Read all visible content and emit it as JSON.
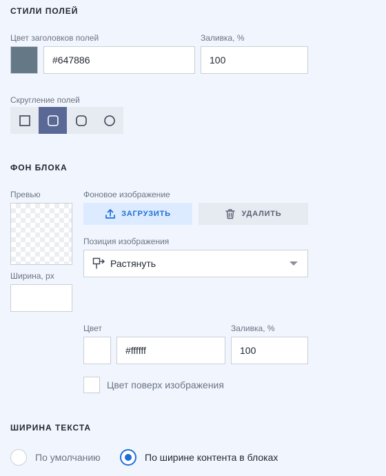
{
  "field_styles": {
    "title": "СТИЛИ ПОЛЕЙ",
    "header_color_label": "Цвет заголовков полей",
    "header_color_value": "#647886",
    "header_color_swatch": "#647886",
    "fill_label": "Заливка, %",
    "fill_value": "100",
    "rounding_label": "Скругление полей",
    "rounding_options": [
      {
        "icon": "square-corner-icon",
        "selected": false
      },
      {
        "icon": "small-rounded-corner-icon",
        "selected": true
      },
      {
        "icon": "rounded-corner-icon",
        "selected": false
      },
      {
        "icon": "circle-corner-icon",
        "selected": false
      }
    ]
  },
  "block_background": {
    "title": "ФОН БЛОКА",
    "preview_label": "Превью",
    "bg_image_label": "Фоновое изображение",
    "upload_label": "ЗАГРУЗИТЬ",
    "delete_label": "УДАЛИТЬ",
    "position_label": "Позиция изображения",
    "position_value": "Растянуть",
    "width_label": "Ширина, px",
    "width_value": "",
    "color_label": "Цвет",
    "color_value": "#ffffff",
    "color_swatch": "#ffffff",
    "fill_label": "Заливка, %",
    "fill_value": "100",
    "overlay_label": "Цвет поверх изображения",
    "overlay_checked": false
  },
  "text_width": {
    "title": "ШИРИНА ТЕКСТА",
    "options": [
      {
        "label": "По умолчанию",
        "selected": false
      },
      {
        "label": "По ширине контента в блоках",
        "selected": true
      }
    ]
  },
  "colors": {
    "accent": "#1e6ed6",
    "segment_active": "#5a6896",
    "background": "#f1f6fe"
  }
}
